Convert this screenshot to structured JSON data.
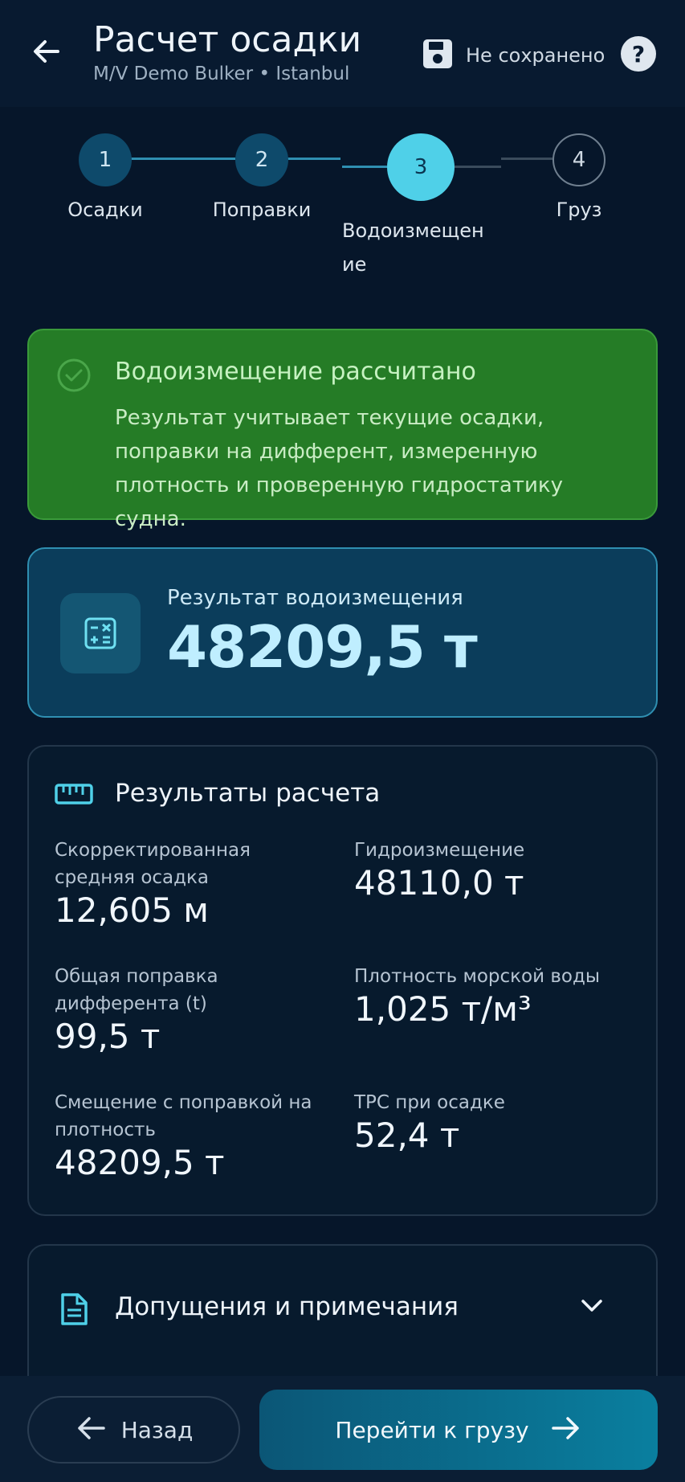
{
  "header": {
    "title": "Расчет осадки",
    "subtitle": "M/V Demo Bulker • Istanbul",
    "save_status": "Не сохранено"
  },
  "stepper": {
    "steps": [
      {
        "number": "1",
        "label": "Осадки",
        "state": "done"
      },
      {
        "number": "2",
        "label": "Поправки",
        "state": "done"
      },
      {
        "number": "3",
        "label": "Водоизмещен ие",
        "state": "active"
      },
      {
        "number": "4",
        "label": "Груз",
        "state": "pending"
      }
    ]
  },
  "banner": {
    "title": "Водоизмещение рассчитано",
    "text": "Результат учитывает текущие осадки, поправки на дифферент, измеренную плотность и проверенную гидростатику судна."
  },
  "result": {
    "label": "Результат водоизмещения",
    "value": "48209,5 т"
  },
  "calc": {
    "title": "Результаты расчета",
    "metrics": [
      {
        "label": "Скорректированная средняя осадка",
        "value": "12,605 м"
      },
      {
        "label": "Гидроизмещение",
        "value": "48110,0 т"
      },
      {
        "label": "Общая поправка дифферента (t)",
        "value": "99,5 т"
      },
      {
        "label": "Плотность морской воды",
        "value": "1,025 т/м³"
      },
      {
        "label": "Смещение с поправкой на плотность",
        "value": "48209,5 т"
      },
      {
        "label": "TPC при осадке",
        "value": "52,4 т"
      }
    ]
  },
  "notes": {
    "title": "Допущения и примечания"
  },
  "footer": {
    "back_label": "Назад",
    "next_label": "Перейти к грузу"
  },
  "colors": {
    "background": "#06162a",
    "accent": "#4fd0e8",
    "success": "#257c26"
  },
  "icons": {
    "back": "arrow-left-icon",
    "save": "floppy-disk-icon",
    "help": "help-circle-icon",
    "success": "check-circle-icon",
    "result": "calculator-icon",
    "calc": "ruler-icon",
    "notes": "document-icon",
    "expand": "chevron-down-icon",
    "next": "arrow-right-icon"
  }
}
